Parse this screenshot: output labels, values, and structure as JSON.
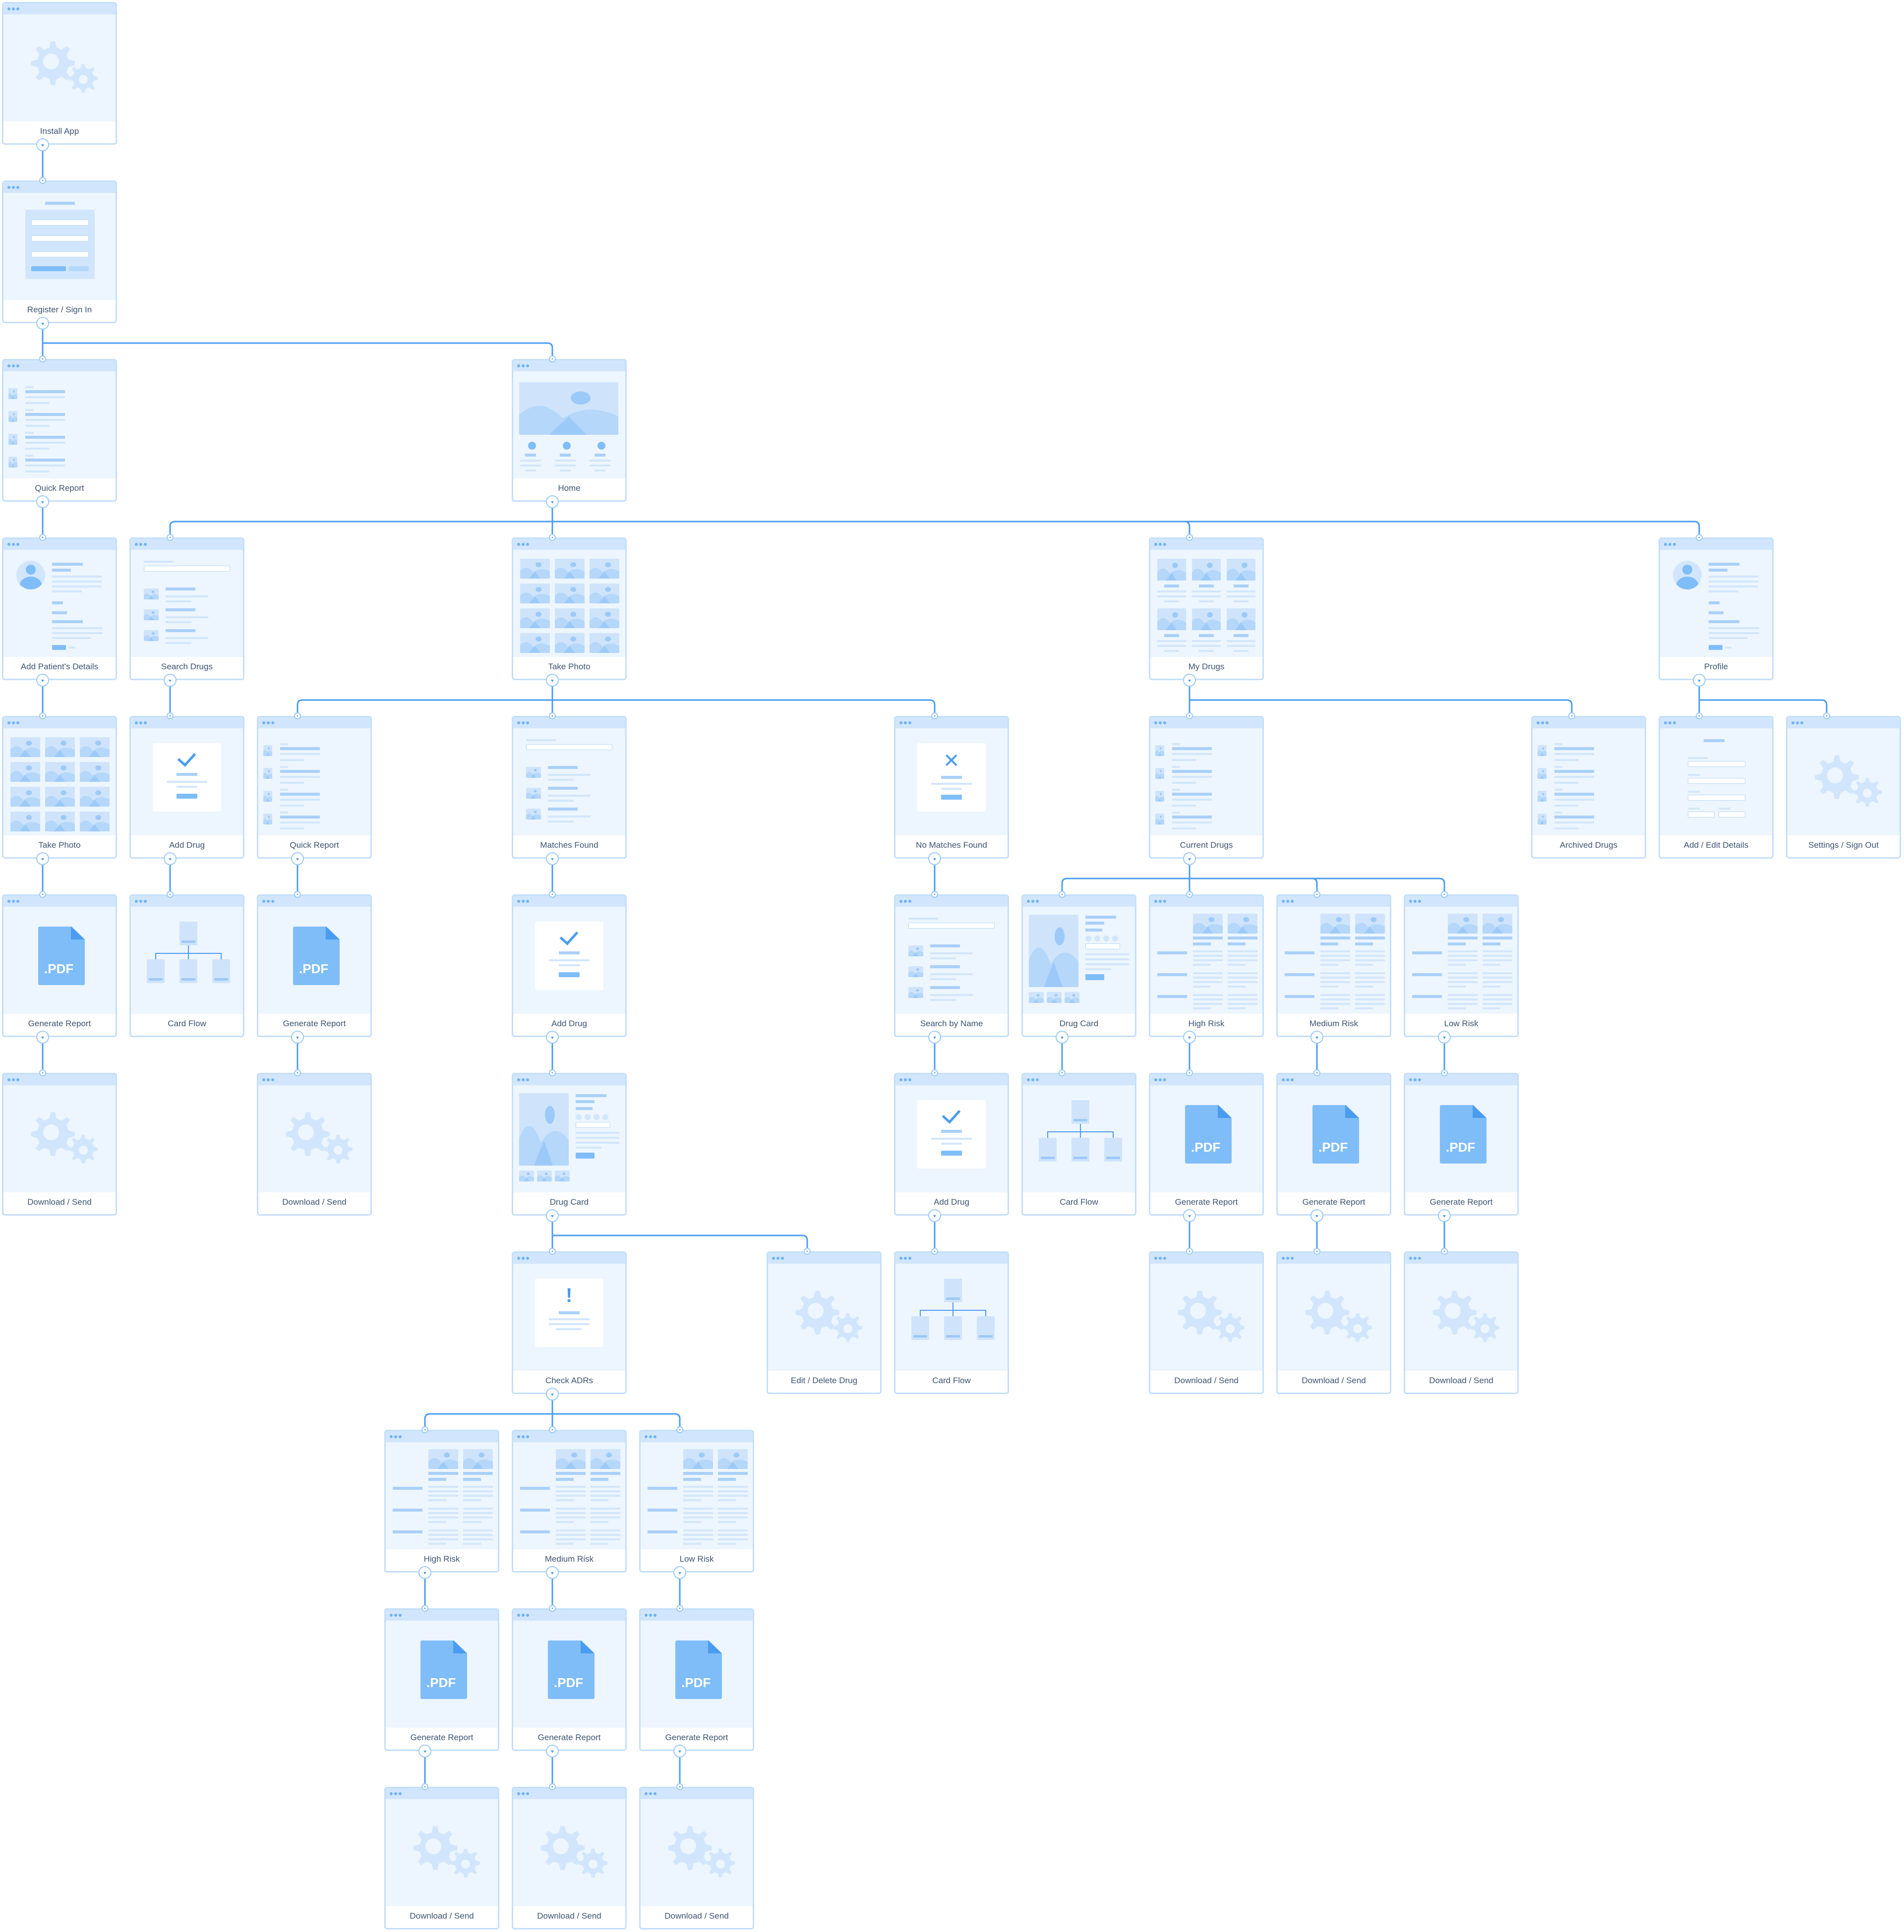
{
  "diagram": {
    "title": "",
    "colors": {
      "connector": "#4a9cf0",
      "card_border": "#c4dffb",
      "card_header": "#d1e6fc",
      "card_body": "#edf5fe",
      "label_text": "#3e5473",
      "accent": "#7fbdf8"
    },
    "nodes": [
      {
        "id": "n1",
        "label": "Install App",
        "template": "gears",
        "col": 0,
        "row": 0
      },
      {
        "id": "n2",
        "label": "Register / Sign In",
        "template": "form",
        "col": 0,
        "row": 1
      },
      {
        "id": "n3",
        "label": "Quick Report",
        "template": "list",
        "col": 0,
        "row": 2
      },
      {
        "id": "n4",
        "label": "Home",
        "template": "home",
        "col": 4,
        "row": 2
      },
      {
        "id": "n5",
        "label": "Add Patient's Details",
        "template": "profile",
        "col": 0,
        "row": 3
      },
      {
        "id": "n6",
        "label": "Search Drugs",
        "template": "search",
        "col": 1,
        "row": 3
      },
      {
        "id": "n7",
        "label": "Take Photo",
        "template": "gallery",
        "col": 4,
        "row": 3
      },
      {
        "id": "n8",
        "label": "My Drugs",
        "template": "grid",
        "col": 9,
        "row": 3
      },
      {
        "id": "n9",
        "label": "Profile",
        "template": "profile",
        "col": 13,
        "row": 3
      },
      {
        "id": "n10",
        "label": "Take Photo",
        "template": "gallery",
        "col": 0,
        "row": 4
      },
      {
        "id": "n11",
        "label": "Add Drug",
        "template": "check",
        "col": 1,
        "row": 4
      },
      {
        "id": "n12",
        "label": "Quick Report",
        "template": "list",
        "col": 2,
        "row": 4
      },
      {
        "id": "n13",
        "label": "Matches Found",
        "template": "search",
        "col": 4,
        "row": 4
      },
      {
        "id": "n14",
        "label": "No Matches Found",
        "template": "cross",
        "col": 7,
        "row": 4
      },
      {
        "id": "n15",
        "label": "Current Drugs",
        "template": "list",
        "col": 9,
        "row": 4
      },
      {
        "id": "n16",
        "label": "Archived Drugs",
        "template": "list",
        "col": 12,
        "row": 4
      },
      {
        "id": "n17",
        "label": "Add / Edit Details",
        "template": "form2",
        "col": 13,
        "row": 4
      },
      {
        "id": "n18",
        "label": "Settings / Sign Out",
        "template": "gears",
        "col": 14,
        "row": 4
      },
      {
        "id": "n19",
        "label": "Generate Report",
        "template": "pdf",
        "col": 0,
        "row": 5
      },
      {
        "id": "n20",
        "label": "Card Flow",
        "template": "flow",
        "col": 1,
        "row": 5
      },
      {
        "id": "n21",
        "label": "Generate Report",
        "template": "pdf",
        "col": 2,
        "row": 5
      },
      {
        "id": "n22",
        "label": "Add Drug",
        "template": "check",
        "col": 4,
        "row": 5
      },
      {
        "id": "n23",
        "label": "Search by Name",
        "template": "search",
        "col": 7,
        "row": 5
      },
      {
        "id": "n24",
        "label": "Drug Card",
        "template": "drugcard",
        "col": 8,
        "row": 5
      },
      {
        "id": "n25",
        "label": "High Risk",
        "template": "risk",
        "col": 9,
        "row": 5
      },
      {
        "id": "n26",
        "label": "Medium Risk",
        "template": "risk",
        "col": 10,
        "row": 5
      },
      {
        "id": "n27",
        "label": "Low Risk",
        "template": "risk",
        "col": 11,
        "row": 5
      },
      {
        "id": "n28",
        "label": "Download / Send",
        "template": "gears",
        "col": 0,
        "row": 6
      },
      {
        "id": "n29",
        "label": "Download / Send",
        "template": "gears",
        "col": 2,
        "row": 6
      },
      {
        "id": "n30",
        "label": "Drug Card",
        "template": "drugcard",
        "col": 4,
        "row": 6
      },
      {
        "id": "n31",
        "label": "Add Drug",
        "template": "check",
        "col": 7,
        "row": 6
      },
      {
        "id": "n32",
        "label": "Card Flow",
        "template": "flow",
        "col": 8,
        "row": 6
      },
      {
        "id": "n33",
        "label": "Generate Report",
        "template": "pdf",
        "col": 9,
        "row": 6
      },
      {
        "id": "n34",
        "label": "Generate Report",
        "template": "pdf",
        "col": 10,
        "row": 6
      },
      {
        "id": "n35",
        "label": "Generate Report",
        "template": "pdf",
        "col": 11,
        "row": 6
      },
      {
        "id": "n36",
        "label": "Check ADRs",
        "template": "alert",
        "col": 4,
        "row": 7
      },
      {
        "id": "n37",
        "label": "Edit / Delete Drug",
        "template": "gears",
        "col": 6,
        "row": 7
      },
      {
        "id": "n38",
        "label": "Card Flow",
        "template": "flow",
        "col": 7,
        "row": 7
      },
      {
        "id": "n39",
        "label": "Download / Send",
        "template": "gears",
        "col": 9,
        "row": 7
      },
      {
        "id": "n40",
        "label": "Download / Send",
        "template": "gears",
        "col": 10,
        "row": 7
      },
      {
        "id": "n41",
        "label": "Download / Send",
        "template": "gears",
        "col": 11,
        "row": 7
      },
      {
        "id": "n42",
        "label": "High Risk",
        "template": "risk",
        "col": 3,
        "row": 8
      },
      {
        "id": "n43",
        "label": "Medium Risk",
        "template": "risk",
        "col": 4,
        "row": 8
      },
      {
        "id": "n44",
        "label": "Low Risk",
        "template": "risk",
        "col": 5,
        "row": 8
      },
      {
        "id": "n45",
        "label": "Generate Report",
        "template": "pdf",
        "col": 3,
        "row": 9
      },
      {
        "id": "n46",
        "label": "Generate Report",
        "template": "pdf",
        "col": 4,
        "row": 9
      },
      {
        "id": "n47",
        "label": "Generate Report",
        "template": "pdf",
        "col": 5,
        "row": 9
      },
      {
        "id": "n48",
        "label": "Download / Send",
        "template": "gears",
        "col": 3,
        "row": 10
      },
      {
        "id": "n49",
        "label": "Download / Send",
        "template": "gears",
        "col": 4,
        "row": 10
      },
      {
        "id": "n50",
        "label": "Download / Send",
        "template": "gears",
        "col": 5,
        "row": 10
      }
    ],
    "edges": [
      [
        "n1",
        "n2"
      ],
      [
        "n2",
        "n3"
      ],
      [
        "n2",
        "n4"
      ],
      [
        "n3",
        "n5"
      ],
      [
        "n4",
        "n6"
      ],
      [
        "n4",
        "n7"
      ],
      [
        "n4",
        "n8"
      ],
      [
        "n4",
        "n9"
      ],
      [
        "n5",
        "n10"
      ],
      [
        "n6",
        "n11"
      ],
      [
        "n7",
        "n12"
      ],
      [
        "n7",
        "n13"
      ],
      [
        "n7",
        "n14"
      ],
      [
        "n8",
        "n15"
      ],
      [
        "n8",
        "n16"
      ],
      [
        "n9",
        "n17"
      ],
      [
        "n9",
        "n18"
      ],
      [
        "n10",
        "n19"
      ],
      [
        "n11",
        "n20"
      ],
      [
        "n12",
        "n21"
      ],
      [
        "n13",
        "n22"
      ],
      [
        "n14",
        "n23"
      ],
      [
        "n15",
        "n24"
      ],
      [
        "n15",
        "n25"
      ],
      [
        "n15",
        "n26"
      ],
      [
        "n15",
        "n27"
      ],
      [
        "n19",
        "n28"
      ],
      [
        "n21",
        "n29"
      ],
      [
        "n22",
        "n30"
      ],
      [
        "n23",
        "n31"
      ],
      [
        "n24",
        "n32"
      ],
      [
        "n25",
        "n33"
      ],
      [
        "n26",
        "n34"
      ],
      [
        "n27",
        "n35"
      ],
      [
        "n30",
        "n36"
      ],
      [
        "n30",
        "n37"
      ],
      [
        "n31",
        "n38"
      ],
      [
        "n33",
        "n39"
      ],
      [
        "n34",
        "n40"
      ],
      [
        "n35",
        "n41"
      ],
      [
        "n36",
        "n42"
      ],
      [
        "n36",
        "n43"
      ],
      [
        "n36",
        "n44"
      ],
      [
        "n42",
        "n45"
      ],
      [
        "n43",
        "n46"
      ],
      [
        "n44",
        "n47"
      ],
      [
        "n45",
        "n48"
      ],
      [
        "n46",
        "n49"
      ],
      [
        "n47",
        "n50"
      ]
    ],
    "pdf_icon_text": ".PDF"
  }
}
